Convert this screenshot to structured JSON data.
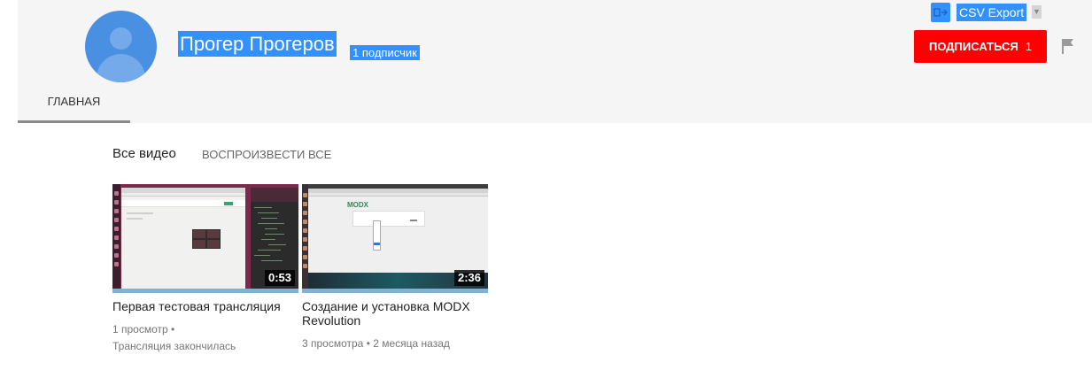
{
  "header": {
    "channel_name": "Прогер Прогеров",
    "subscriber_count": "1 подписчик",
    "subscribe_label": "ПОДПИСАТЬСЯ",
    "subscribe_count": "1",
    "tabs": [
      {
        "label": "ГЛАВНАЯ",
        "active": true
      }
    ]
  },
  "extension": {
    "label": "CSV Export",
    "dropdown_glyph": "▼"
  },
  "section": {
    "title": "Все видео",
    "play_all": "ВОСПРОИЗВЕСТИ ВСЕ"
  },
  "videos": [
    {
      "title": "Первая тестовая трансляция",
      "duration": "0:53",
      "views": "1 просмотр",
      "status": "Трансляция закончилась",
      "watched_fraction": 1.0
    },
    {
      "title": "Создание и установка MODX Revolution",
      "duration": "2:36",
      "views": "3 просмотра",
      "age": "2 месяца назад",
      "watched_fraction": 1.0,
      "thumb_logo": "MODX"
    }
  ],
  "colors": {
    "accent_red": "#ff0000",
    "selection_blue": "#3390ff",
    "avatar_blue": "#4a90e2",
    "progress_blue": "#7fb3d5"
  },
  "icons": [
    "avatar-icon",
    "csv-export-icon",
    "flag-icon"
  ]
}
